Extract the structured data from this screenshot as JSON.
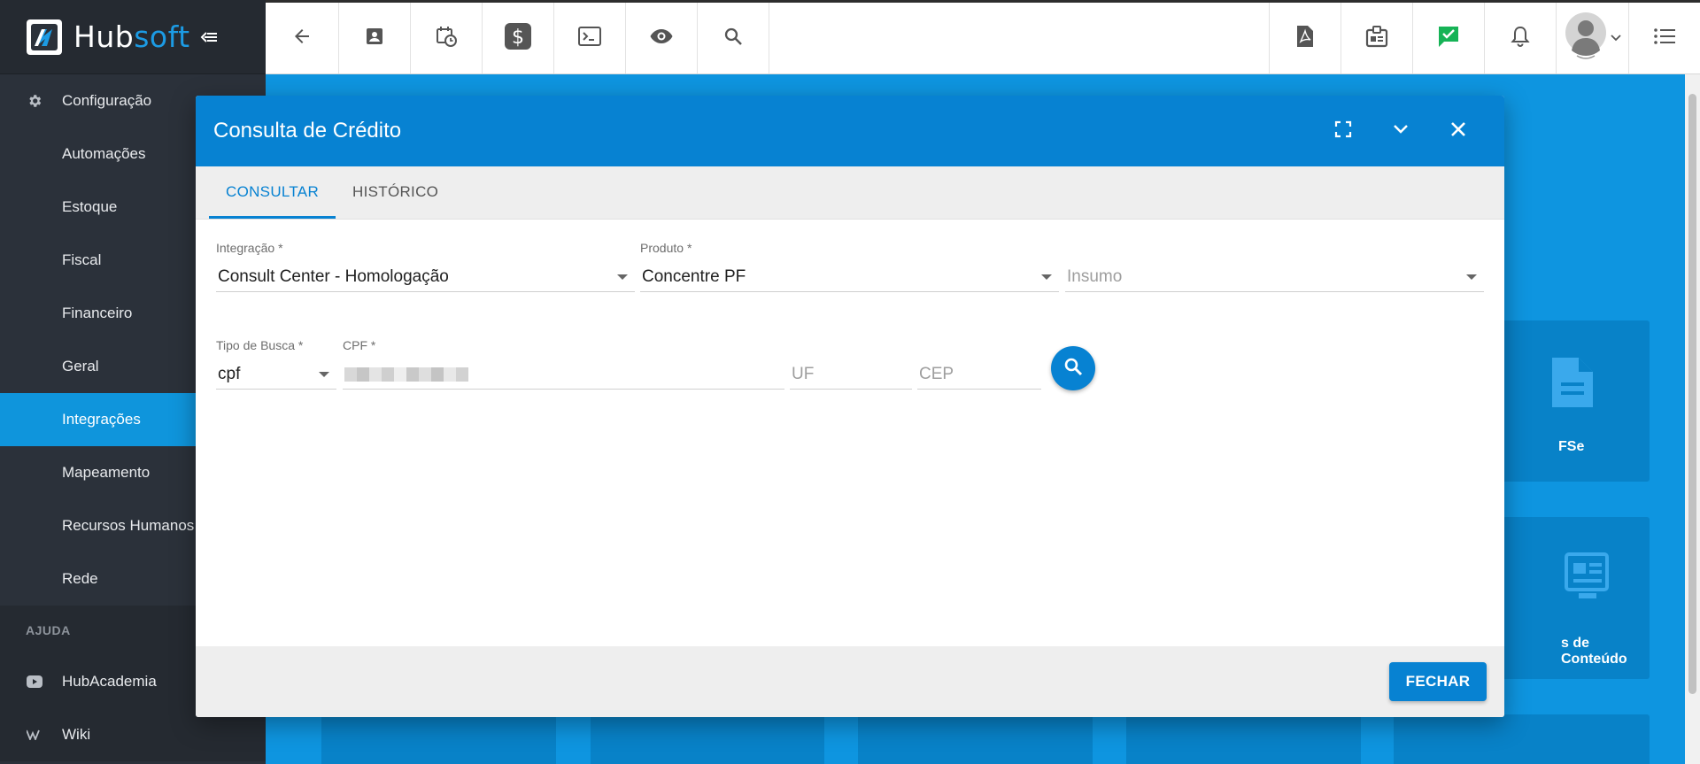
{
  "brand": {
    "name_part1": "Hub",
    "name_part2": "soft"
  },
  "sidebar": {
    "items": [
      {
        "label": "Configuração",
        "icon": "gear-icon"
      },
      {
        "label": "Automações"
      },
      {
        "label": "Estoque"
      },
      {
        "label": "Fiscal"
      },
      {
        "label": "Financeiro"
      },
      {
        "label": "Geral"
      },
      {
        "label": "Integrações",
        "active": true
      },
      {
        "label": "Mapeamento"
      },
      {
        "label": "Recursos Humanos"
      },
      {
        "label": "Rede"
      }
    ],
    "help_section": "AJUDA",
    "help_items": [
      {
        "label": "HubAcademia",
        "icon": "youtube-icon"
      },
      {
        "label": "Wiki",
        "icon": "wikipedia-icon"
      }
    ]
  },
  "topbar": {
    "left_icons": [
      "back-arrow-icon",
      "contact-card-icon",
      "calendar-clock-icon",
      "dollar-icon",
      "terminal-icon",
      "eye-icon",
      "search-icon"
    ],
    "right_icons": [
      "pdf-file-icon",
      "id-badge-icon",
      "chat-check-icon",
      "bell-icon",
      "avatar",
      "list-menu-icon"
    ]
  },
  "background_cards": [
    {
      "label": "FSe"
    },
    {
      "label": "s de Conteúdo"
    }
  ],
  "modal": {
    "title": "Consulta de Crédito",
    "tabs": [
      {
        "label": "CONSULTAR",
        "active": true
      },
      {
        "label": "HISTÓRICO"
      }
    ],
    "fields": {
      "integracao": {
        "label": "Integração",
        "required_mark": "*",
        "value": "Consult Center - Homologação"
      },
      "produto": {
        "label": "Produto",
        "required_mark": "*",
        "value": "Concentre PF"
      },
      "insumo": {
        "placeholder": "Insumo"
      },
      "tipo_busca": {
        "label": "Tipo de Busca",
        "required_mark": "*",
        "value": "cpf"
      },
      "cpf": {
        "label": "CPF",
        "required_mark": "*"
      },
      "uf": {
        "placeholder": "UF"
      },
      "cep": {
        "placeholder": "CEP"
      }
    },
    "footer": {
      "close_label": "FECHAR"
    }
  },
  "colors": {
    "primary": "#0782d2",
    "sidebar_bg": "#2b313a",
    "sidebar_active": "#0f95dc",
    "main_bg": "#0e95e0",
    "chat_icon_green": "#16b356"
  }
}
